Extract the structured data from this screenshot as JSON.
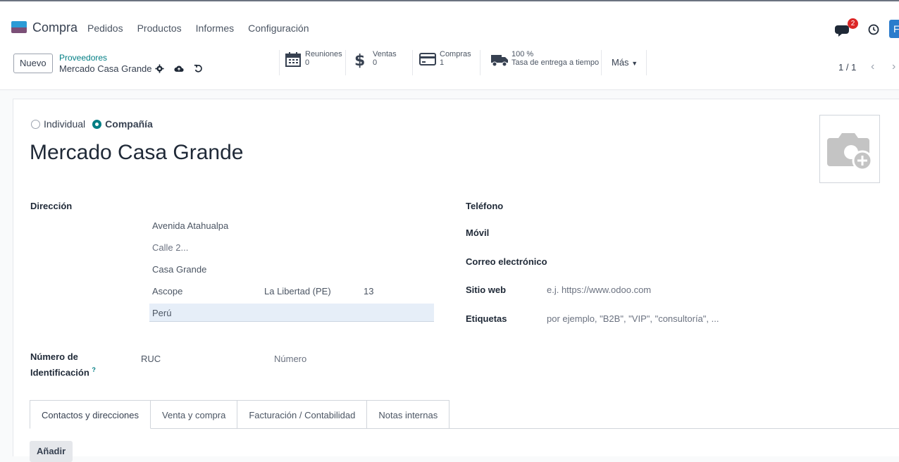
{
  "app": {
    "name": "Compra",
    "logo_colors": [
      "#2b9bd6",
      "#7b4f77"
    ]
  },
  "menu": [
    "Pedidos",
    "Productos",
    "Informes",
    "Configuración"
  ],
  "systray": {
    "chat_count": "2",
    "avatar_letter": "F"
  },
  "control": {
    "new_label": "Nuevo",
    "breadcrumb_parent": "Proveedores",
    "breadcrumb_current": "Mercado Casa Grande",
    "smart_buttons": [
      {
        "label": "Reuniones",
        "value": "0",
        "icon": "calendar-icon"
      },
      {
        "label": "Ventas",
        "value": "0",
        "icon": "dollar-icon"
      },
      {
        "label": "Compras",
        "value": "1",
        "icon": "credit-card-icon"
      },
      {
        "label": "100 %",
        "value": "Tasa de entrega a tiempo",
        "icon": "truck-icon"
      }
    ],
    "more_label": "Más",
    "pager": "1 / 1"
  },
  "form": {
    "type_options": [
      "Individual",
      "Compañía"
    ],
    "type_selected": "Compañía",
    "name": "Mercado Casa Grande",
    "address_label": "Dirección",
    "street": "Avenida Atahualpa",
    "street2_placeholder": "Calle 2...",
    "city_line": "Casa Grande",
    "city": "Ascope",
    "state": "La Libertad (PE)",
    "zip": "13",
    "country": "Perú",
    "id_label_1": "Número de",
    "id_label_2": "Identificación",
    "id_help": "?",
    "id_type": "RUC",
    "id_number_placeholder": "Número",
    "phone_label": "Teléfono",
    "mobile_label": "Móvil",
    "email_label": "Correo electrónico",
    "website_label": "Sitio web",
    "website_placeholder": "e.j. https://www.odoo.com",
    "tags_label": "Etiquetas",
    "tags_placeholder": "por ejemplo, \"B2B\", \"VIP\", \"consultoría\", ..."
  },
  "tabs": [
    "Contactos y direcciones",
    "Venta y compra",
    "Facturación / Contabilidad",
    "Notas internas"
  ],
  "add_label": "Añadir",
  "colors": {
    "accent": "#017e84",
    "badge": "#dc2626"
  }
}
